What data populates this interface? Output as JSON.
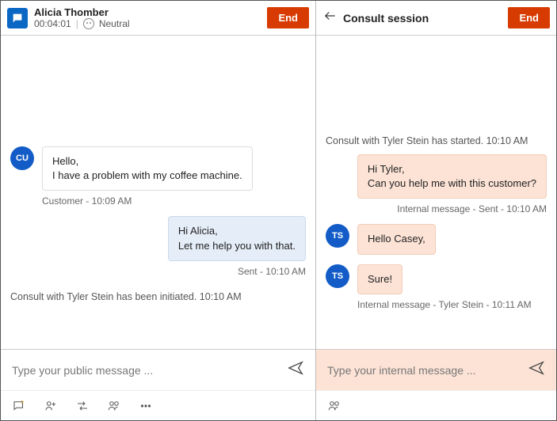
{
  "left": {
    "header": {
      "name": "Alicia Thomber",
      "timer": "00:04:01",
      "sentiment": "Neutral",
      "end_label": "End"
    },
    "messages": {
      "customer_avatar": "CU",
      "customer_line1": "Hello,",
      "customer_line2": "I have a problem with my coffee machine.",
      "customer_meta": "Customer - 10:09 AM",
      "agent_line1": "Hi Alicia,",
      "agent_line2": "Let me help you with that.",
      "agent_meta": "Sent - 10:10 AM",
      "system": "Consult with Tyler Stein has been initiated. 10:10 AM"
    },
    "composer_placeholder": "Type your public message ..."
  },
  "right": {
    "header": {
      "title": "Consult session",
      "end_label": "End"
    },
    "messages": {
      "started": "Consult with Tyler Stein has started. 10:10 AM",
      "out_line1": "Hi Tyler,",
      "out_line2": "Can you help me with this customer?",
      "out_meta": "Internal message - Sent - 10:10 AM",
      "ts_avatar": "TS",
      "in1": "Hello Casey,",
      "in2": "Sure!",
      "in_meta": "Internal message - Tyler Stein - 10:11 AM"
    },
    "composer_placeholder": "Type your internal message ..."
  }
}
